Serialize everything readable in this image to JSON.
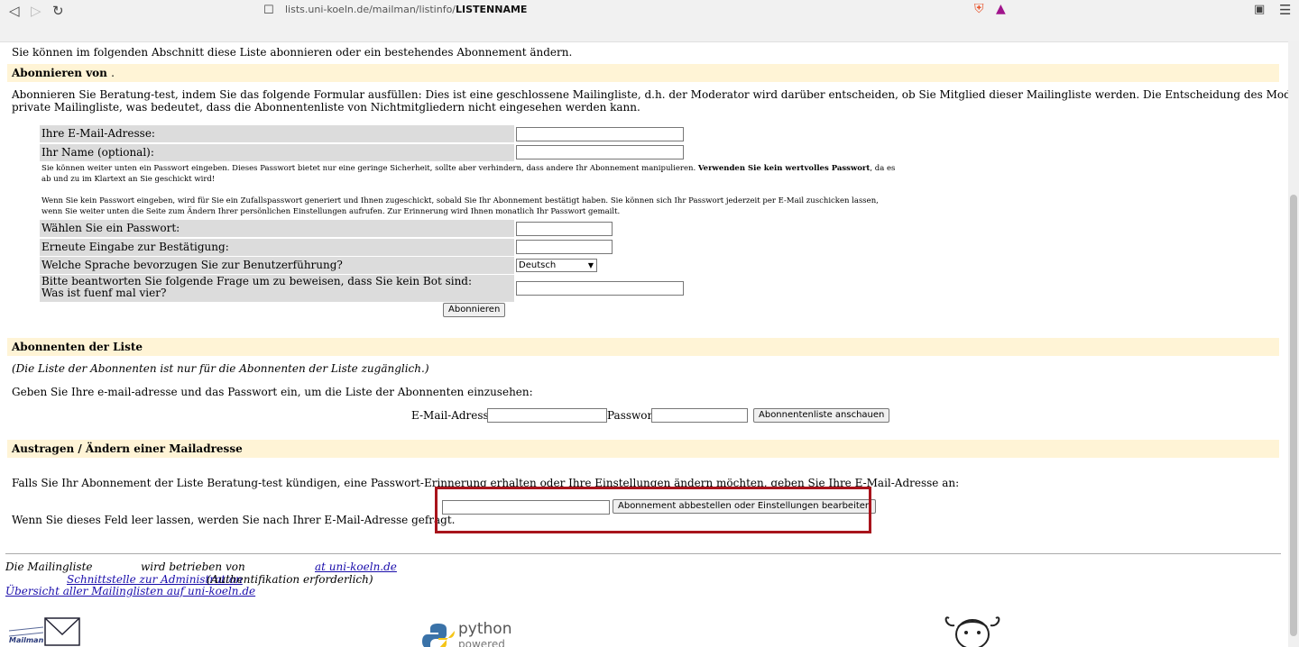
{
  "browser": {
    "url_host": "lists.uni-koeln.de/mailman/listinfo/",
    "url_path": "LISTENNAME"
  },
  "intro": "Sie können im folgenden Abschnitt diese Liste abonnieren oder ein bestehendes Abonnement ändern.",
  "subscribe": {
    "heading": "Abonnieren von",
    "heading_suffix": ".",
    "description_1": "Abonnieren Sie Beratung-test, indem Sie das folgende Formular ausfüllen: Dies ist eine geschlossene Mailingliste, d.h. der Moderator wird darüber entscheiden, ob Sie Mitglied dieser Mailingliste werden. Die Entscheidung des Moderators wird Ihnen per E-Mail mitgeteilt. Dies ist auch eine",
    "description_2": "private Mailingliste, was bedeutet, dass die Abonnentenliste von Nichtmitgliedern nicht eingesehen werden kann.",
    "email_label": "Ihre E-Mail-Adresse:",
    "name_label": "Ihr Name (optional):",
    "pw_note_1a": "Sie können weiter unten ein Passwort eingeben. Dieses Passwort bietet nur eine geringe Sicherheit, sollte aber verhindern, dass andere Ihr Abonnement manipulieren.",
    "pw_note_1b": "Verwenden Sie kein wertvolles Passwort",
    "pw_note_1c": ", da es ab und zu im Klartext an Sie geschickt wird!",
    "pw_note_2": "Wenn Sie kein Passwort eingeben, wird für Sie ein Zufallspasswort generiert und Ihnen zugeschickt, sobald Sie Ihr Abonnement bestätigt haben. Sie können sich Ihr Passwort jederzeit per E-Mail zuschicken lassen, wenn Sie weiter unten die Seite zum Ändern Ihrer persönlichen Einstellungen aufrufen. Zur Erinnerung wird Ihnen monatlich Ihr Passwort gemailt.",
    "password_label": "Wählen Sie ein Passwort:",
    "confirm_label": "Erneute Eingabe zur Bestätigung:",
    "language_label": "Welche Sprache bevorzugen Sie zur Benutzerführung?",
    "language_value": "Deutsch",
    "captcha_label_1": "Bitte beantworten Sie folgende Frage um zu beweisen, dass Sie kein Bot sind:",
    "captcha_label_2": "Was ist fuenf mal vier?",
    "submit_label": "Abonnieren"
  },
  "subscribers": {
    "heading": "Abonnenten der Liste",
    "note": "(Die Liste der Abonnenten ist nur für die Abonnenten der Liste zugänglich.)",
    "instruction": "Geben Sie Ihre e-mail-adresse und das Passwort ein, um die Liste der Abonnenten einzusehen:",
    "email_label": "E-Mail-Adresse:",
    "password_label": "Passwort:",
    "button_label": "Abonnentenliste anschauen"
  },
  "unsubscribe": {
    "heading": "Austragen / Ändern einer Mailadresse",
    "instruction": "Falls Sie Ihr Abonnement der Liste Beratung-test kündigen, eine Passwort-Erinnerung erhalten oder Ihre Einstellungen ändern möchten, geben Sie Ihre E-Mail-Adresse an:",
    "hint": "Wenn Sie dieses Feld leer lassen, werden Sie nach Ihrer E-Mail-Adresse gefragt.",
    "button_label": "Abonnement abbestellen oder Einstellungen bearbeiten"
  },
  "footer": {
    "line1_a": "Die Mailingliste",
    "line1_b": "wird betrieben von",
    "line1_link": "at uni-koeln.de",
    "admin_link": "Schnittstelle zur Administration",
    "admin_note": "(Authentifikation erforderlich)",
    "overview_link": "Übersicht aller Mailinglisten auf uni-koeln.de"
  },
  "logos": {
    "mailman": "Mailman",
    "python_1": "python",
    "python_2": "powered"
  }
}
